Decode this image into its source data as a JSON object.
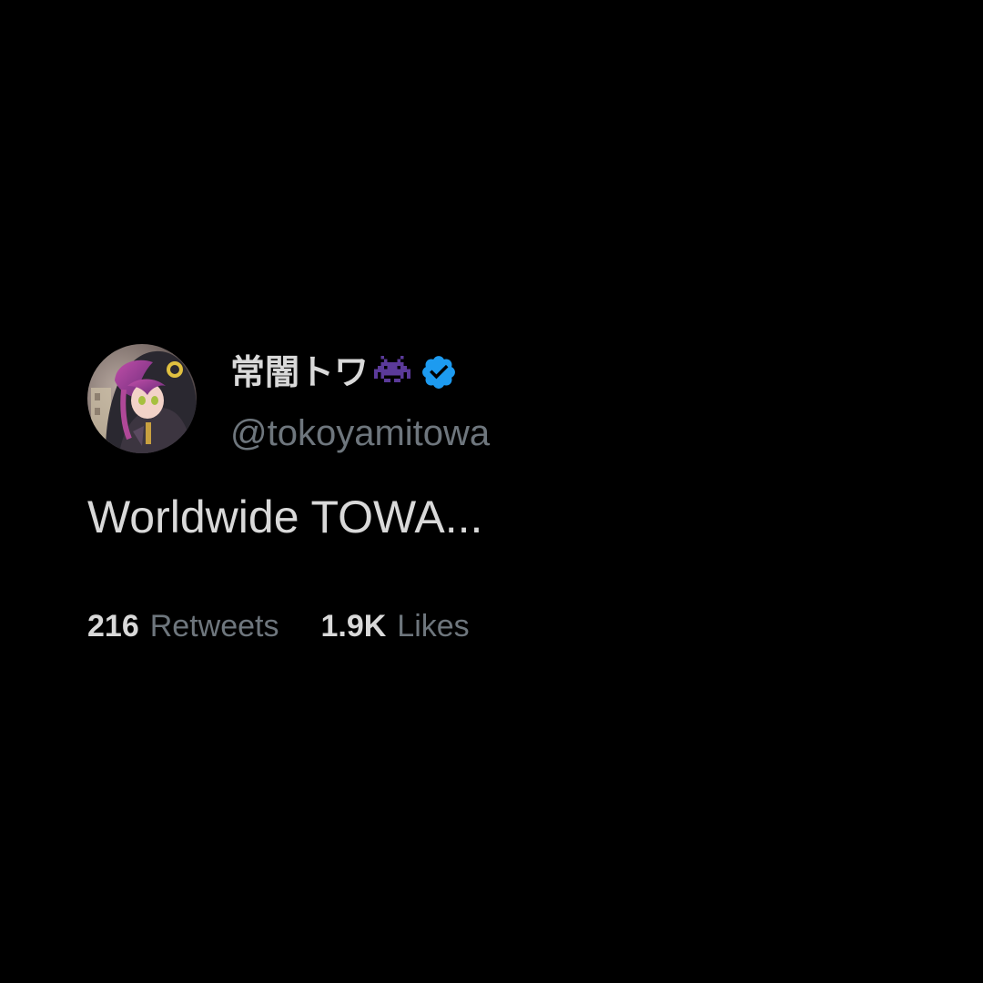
{
  "tweet": {
    "display_name": "常闇トワ",
    "name_emoji_icon": "space-invader-icon",
    "verified_icon": "verified-badge-icon",
    "handle": "@tokoyamitowa",
    "text": "Worldwide TOWA...",
    "avatar": "profile-avatar-image"
  },
  "stats": {
    "retweets_value": "216",
    "retweets_label": "Retweets",
    "likes_value": "1.9K",
    "likes_label": "Likes"
  },
  "colors": {
    "background": "#000000",
    "primary_text": "#d9d9d9",
    "secondary_text": "#6e767d",
    "verified_blue": "#1d9bf0",
    "invader_purple": "#5b3a9a"
  }
}
